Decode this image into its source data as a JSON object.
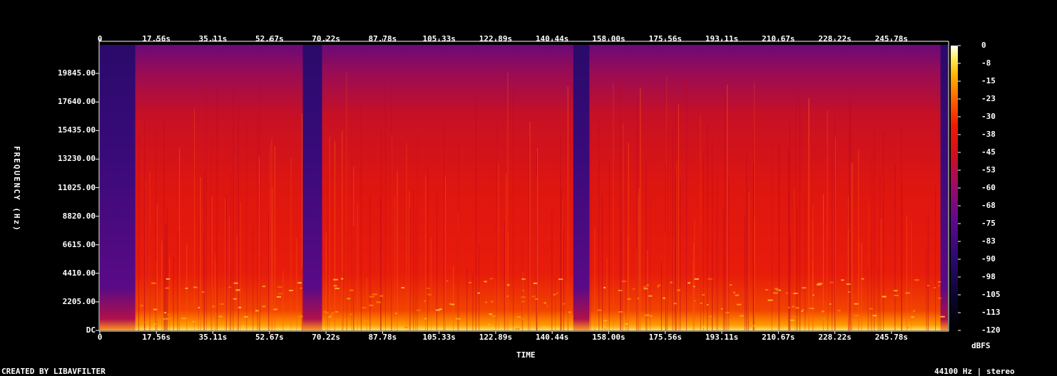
{
  "chart_data": {
    "type": "heatmap",
    "title": "",
    "xlabel": "TIME",
    "ylabel": "FREQUENCY (Hz)",
    "x_ticks": [
      "0",
      "17.56s",
      "35.11s",
      "52.67s",
      "70.22s",
      "87.78s",
      "105.33s",
      "122.89s",
      "140.44s",
      "158.00s",
      "175.56s",
      "193.11s",
      "210.67s",
      "228.22s",
      "245.78s"
    ],
    "x_tick_values_s": [
      0,
      17.56,
      35.11,
      52.67,
      70.22,
      87.78,
      105.33,
      122.89,
      140.44,
      158.0,
      175.56,
      193.11,
      210.67,
      228.22,
      245.78
    ],
    "xlim_s": [
      0,
      263.3
    ],
    "y_ticks": [
      "DC",
      "2205.00",
      "4410.00",
      "6615.00",
      "8820.00",
      "11025.00",
      "13230.00",
      "15435.00",
      "17640.00",
      "19845.00"
    ],
    "y_tick_values_hz": [
      0,
      2205,
      4410,
      6615,
      8820,
      11025,
      13230,
      15435,
      17640,
      19845
    ],
    "ylim_hz": [
      0,
      22050
    ],
    "colorbar": {
      "label": "dBFS",
      "ticks": [
        "0",
        "-8",
        "-15",
        "-23",
        "-30",
        "-38",
        "-45",
        "-53",
        "-60",
        "-68",
        "-75",
        "-83",
        "-90",
        "-98",
        "-105",
        "-113",
        "-120"
      ],
      "range_db": [
        -120,
        0
      ]
    },
    "quiet_segments_s": [
      [
        0,
        11
      ],
      [
        63,
        69
      ],
      [
        147,
        152
      ],
      [
        261,
        263.3
      ]
    ]
  },
  "footer": {
    "left": "CREATED BY LIBAVFILTER",
    "right": "44100 Hz | stereo"
  }
}
